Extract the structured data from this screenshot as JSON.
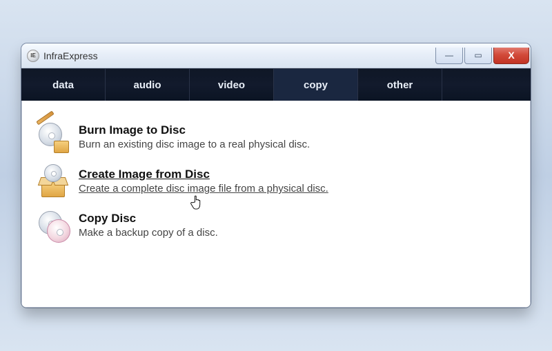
{
  "window": {
    "title": "InfraExpress",
    "icon_label": "IE"
  },
  "win_controls": {
    "minimize": "—",
    "maximize": "▭",
    "close": "X"
  },
  "tabs": [
    {
      "label": "data"
    },
    {
      "label": "audio"
    },
    {
      "label": "video"
    },
    {
      "label": "copy",
      "active": true
    },
    {
      "label": "other"
    }
  ],
  "options": [
    {
      "title": "Burn Image to Disc",
      "desc": "Burn an existing disc image to a real physical disc.",
      "icon": "burn"
    },
    {
      "title": "Create Image from Disc",
      "desc": "Create a complete disc image file from a physical disc.",
      "icon": "create",
      "hover": true
    },
    {
      "title": "Copy Disc",
      "desc": "Make a backup copy of a disc.",
      "icon": "copy"
    }
  ]
}
